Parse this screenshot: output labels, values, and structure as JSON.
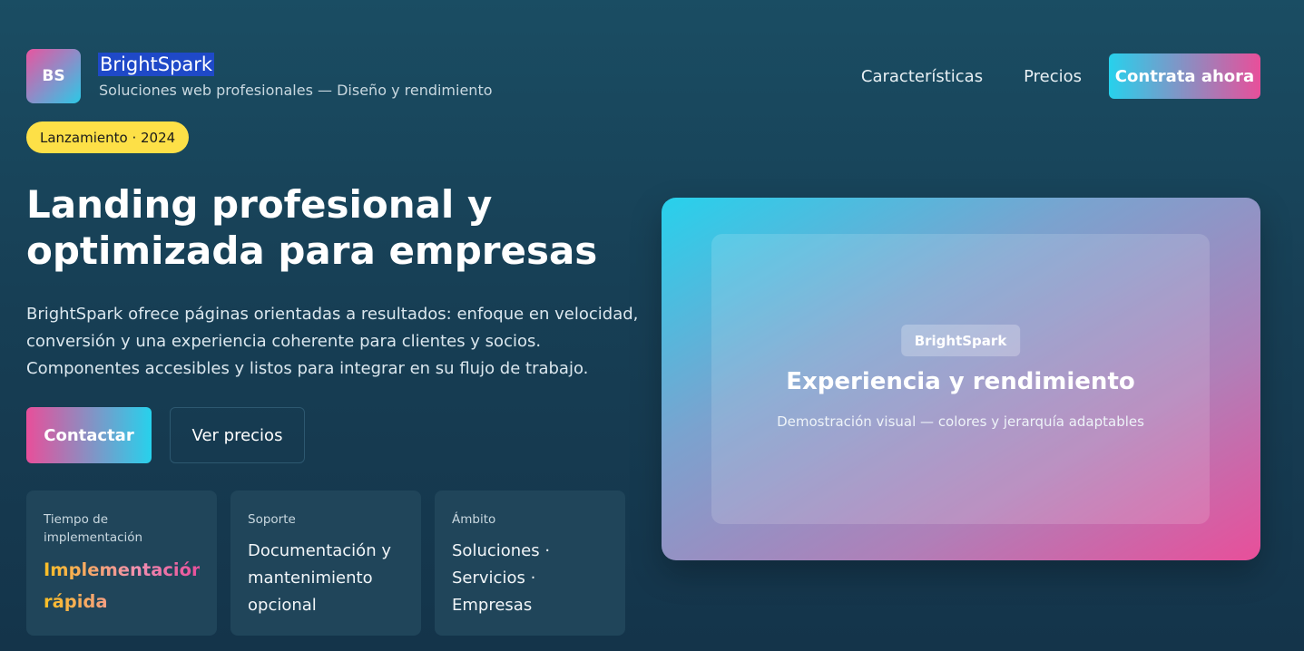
{
  "header": {
    "logo_text": "BS",
    "brand_name": "BrightSpark",
    "tagline": "Soluciones web profesionales — Diseño y rendimiento",
    "nav": [
      {
        "label": "Características"
      },
      {
        "label": "Precios"
      }
    ],
    "cta_label": "Contrata ahora"
  },
  "hero": {
    "badge": "Lanzamiento · 2024",
    "title": "Landing profesional y optimizada para empresas",
    "description": "BrightSpark ofrece páginas orientadas a resultados: enfoque en velocidad, conversión y una experiencia coherente para clientes y socios. Componentes accesibles y listos para integrar en su flujo de trabajo.",
    "primary_button": "Contactar",
    "secondary_button": "Ver precios"
  },
  "cards": [
    {
      "label": "Tiempo de implementación",
      "value_line1": "Implementación",
      "value_line2": "rápida"
    },
    {
      "label": "Soporte",
      "value": "Documentación y mantenimiento opcional"
    },
    {
      "label": "Ámbito",
      "value": "Soluciones · Servicios · Empresas"
    }
  ],
  "showcase": {
    "chip": "BrightSpark",
    "title": "Experiencia y rendimiento",
    "subtitle": "Demostración visual — colores y jerarquía adaptables"
  },
  "colors": {
    "accent_cyan": "#27d1ec",
    "accent_pink": "#e84f9a",
    "badge_yellow": "#fde047",
    "background": "#173f55"
  }
}
